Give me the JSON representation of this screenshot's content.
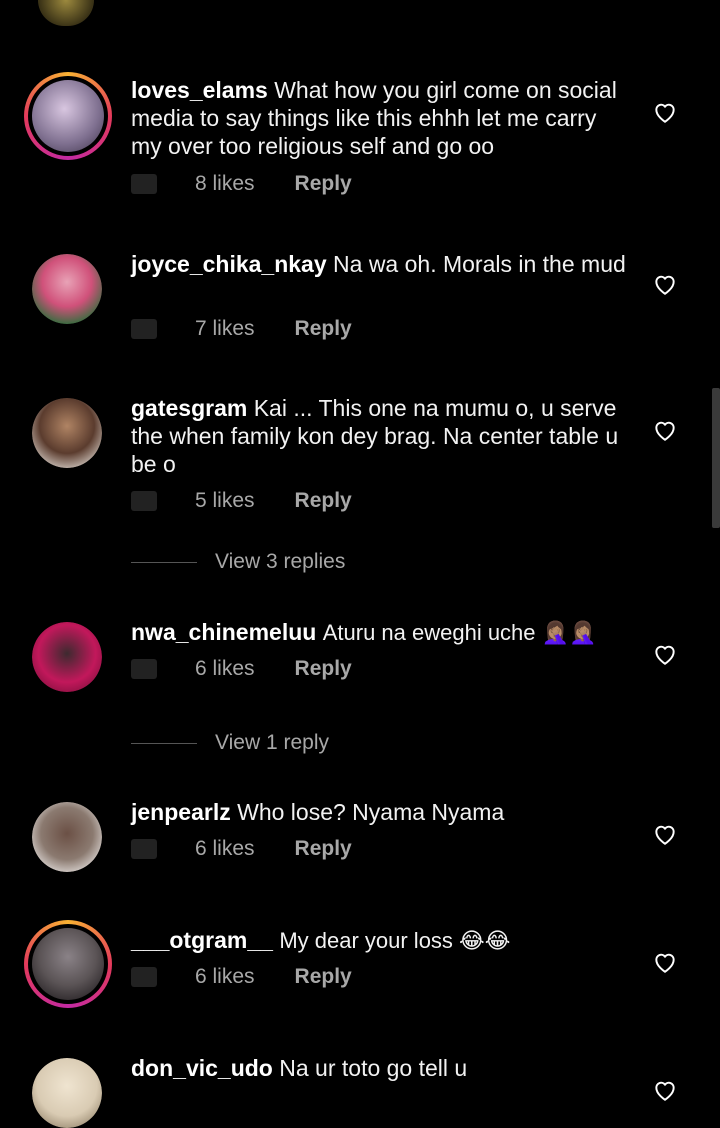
{
  "comments": [
    {
      "username": "loves_elams",
      "text": "What how you girl come on social media to say things like this ehhh  let me carry my over too religious self and go oo",
      "likes": "8 likes",
      "reply": "Reply",
      "avatar_story": true,
      "avatar_color": "#7e6f8f"
    },
    {
      "username": "joyce_chika_nkay",
      "text": "Na wa oh. Morals in the mud",
      "likes": "7 likes",
      "reply": "Reply",
      "avatar_story": false,
      "avatar_color": "#3c8f4f"
    },
    {
      "username": "gatesgram",
      "text": "Kai ... This one na mumu o, u serve the when family kon dey brag. Na center table u be o",
      "likes": "5 likes",
      "reply": "Reply",
      "avatar_story": false,
      "avatar_color": "#4a3c35",
      "view_replies": "View 3 replies"
    },
    {
      "username": "nwa_chinemeluu",
      "text": "Aturu na eweghi uche 🤦🏽‍♀️🤦🏽‍♀️",
      "likes": "6 likes",
      "reply": "Reply",
      "avatar_story": false,
      "avatar_color": "#c2185b",
      "view_replies": "View 1 reply"
    },
    {
      "username": "jenpearlz",
      "text": "Who lose? Nyama Nyama",
      "likes": "6 likes",
      "reply": "Reply",
      "avatar_story": false,
      "avatar_color": "#8b7a70"
    },
    {
      "username": "___otgram__",
      "text": "My dear your loss 😂😂",
      "likes": "6 likes",
      "reply": "Reply",
      "avatar_story": true,
      "avatar_color": "#5b5456"
    },
    {
      "username": "don_vic_udo",
      "text": "Na ur toto go tell u",
      "likes": "",
      "reply": "",
      "avatar_story": false,
      "avatar_color": "#d9cbb3"
    }
  ]
}
